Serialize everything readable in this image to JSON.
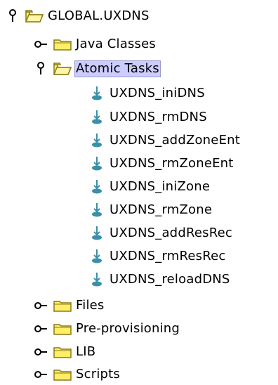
{
  "tree": {
    "root": {
      "label": "GLOBAL.UXDNS",
      "expanded": true
    },
    "java_classes": {
      "label": "Java Classes",
      "expanded": false
    },
    "atomic_tasks": {
      "label": "Atomic Tasks",
      "expanded": true,
      "selected": true,
      "tasks": [
        "UXDNS_iniDNS",
        "UXDNS_rmDNS",
        "UXDNS_addZoneEnt",
        "UXDNS_rmZoneEnt",
        "UXDNS_iniZone",
        "UXDNS_rmZone",
        "UXDNS_addResRec",
        "UXDNS_rmResRec",
        "UXDNS_reloadDNS"
      ]
    },
    "files": {
      "label": "Files",
      "expanded": false
    },
    "pre_provisioning": {
      "label": "Pre-provisioning",
      "expanded": false
    },
    "lib": {
      "label": "LIB",
      "expanded": false
    },
    "scripts": {
      "label": "Scripts",
      "expanded": false
    }
  },
  "colors": {
    "folder_fill": "#ffee66",
    "folder_outline": "#8a7a18",
    "selection": "#ccccff",
    "task_icon": "#3b8fa8"
  }
}
